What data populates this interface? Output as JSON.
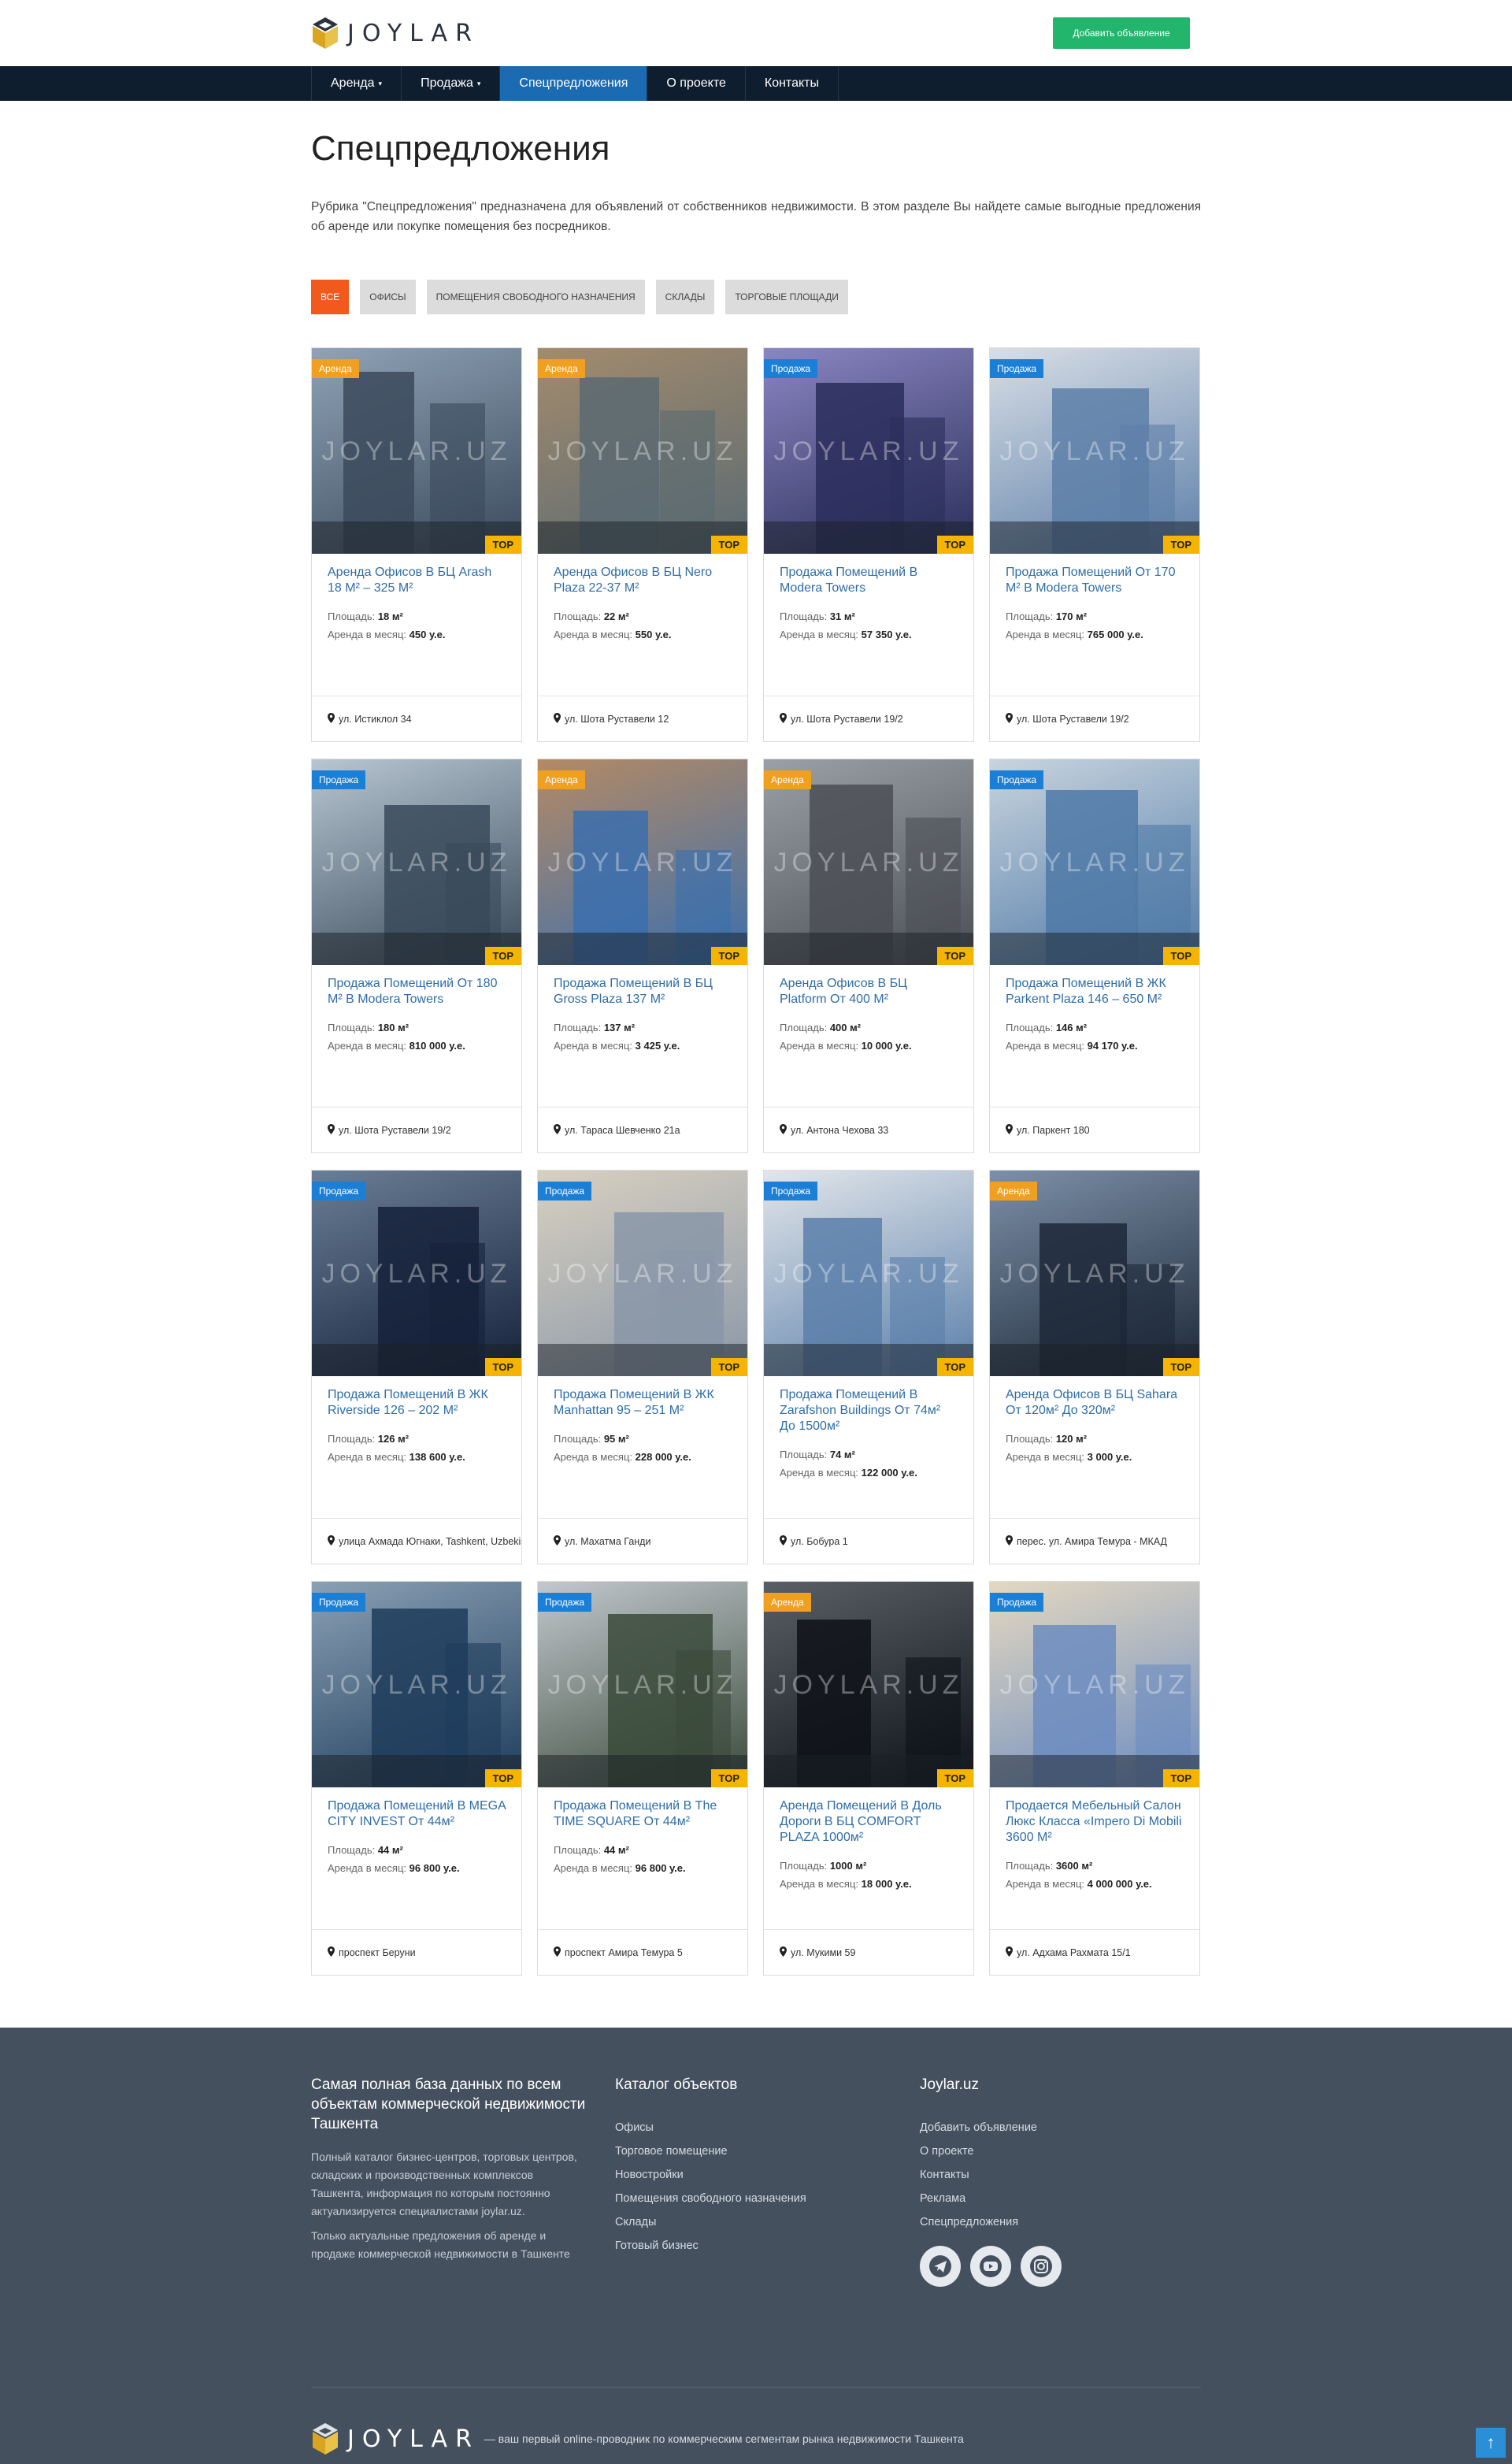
{
  "brand": {
    "name": "JOYLAR",
    "add_button": "Добавить объявление"
  },
  "nav": [
    "Аренда",
    "Продажа",
    "Спецпредложения",
    "О проекте",
    "Контакты"
  ],
  "page": {
    "title": "Спецпредложения",
    "intro": "Рубрика \"Спецпредложения\" предназначена для объявлений от собственников недвижимости. В этом разделе Вы найдете самые выгодные предложения об аренде или покупке помещения без посредников."
  },
  "filters": [
    "Все",
    "Офисы",
    "Помещения свободного назначения",
    "Склады",
    "Торговые площади"
  ],
  "labels": {
    "area": "Площадь:",
    "rent": "Аренда в месяц:",
    "top": "TOP",
    "watermark": "JOYLAR.UZ"
  },
  "colors": {
    "accent": "#f25a1d",
    "nav_bg": "#0f1e2e",
    "nav_active": "#1b6bb3",
    "add_button": "#22b56c",
    "footer_bg": "#45505e",
    "badge_rent": "#f0a020",
    "badge_sale": "#1b7fd6",
    "top_badge": "#f5b400"
  },
  "cards": [
    {
      "badge": "Аренда",
      "type": "rent",
      "title": "Аренда Офисов В БЦ Arash 18 М² – 325 М²",
      "area": "18 м²",
      "price": "450 у.е.",
      "address": "ул. Истиклол 34"
    },
    {
      "badge": "Аренда",
      "type": "rent",
      "title": "Аренда Офисов В БЦ Nero Plaza 22-37 М²",
      "area": "22 м²",
      "price": "550 у.е.",
      "address": "ул. Шота Руставели 12"
    },
    {
      "badge": "Продажа",
      "type": "sale",
      "title": "Продажа Помещений В Modera Towers",
      "area": "31 м²",
      "price": "57 350 у.е.",
      "address": "ул. Шота Руставели 19/2"
    },
    {
      "badge": "Продажа",
      "type": "sale",
      "title": "Продажа Помещений От 170 М² В Modera Towers",
      "area": "170 м²",
      "price": "765 000 у.е.",
      "address": "ул. Шота Руставели 19/2"
    },
    {
      "badge": "Продажа",
      "type": "sale",
      "title": "Продажа Помещений От 180 М² В Modera Towers",
      "area": "180 м²",
      "price": "810 000 у.е.",
      "address": "ул. Шота Руставели 19/2"
    },
    {
      "badge": "Аренда",
      "type": "rent",
      "title": "Продажа Помещений В БЦ Gross Plaza 137 М²",
      "area": "137 м²",
      "price": "3 425 у.е.",
      "address": "ул. Тараса Шевченко 21а"
    },
    {
      "badge": "Аренда",
      "type": "rent",
      "title": "Аренда Офисов В БЦ Platform От 400 М²",
      "area": "400 м²",
      "price": "10 000 у.е.",
      "address": "ул. Антона Чехова 33"
    },
    {
      "badge": "Продажа",
      "type": "sale",
      "title": "Продажа Помещений В ЖК Parkent Plaza 146 – 650 М²",
      "area": "146 м²",
      "price": "94 170 у.е.",
      "address": "ул. Паркент 180"
    },
    {
      "badge": "Продажа",
      "type": "sale",
      "title": "Продажа Помещений В ЖК Riverside 126 – 202 М²",
      "area": "126 м²",
      "price": "138 600 у.е.",
      "address": "улица Ахмада Югнаки, Tashkent, Uzbekistan"
    },
    {
      "badge": "Продажа",
      "type": "sale",
      "title": "Продажа Помещений В ЖК Manhattan 95 – 251 М²",
      "area": "95 м²",
      "price": "228 000 у.е.",
      "address": "ул. Махатма Ганди"
    },
    {
      "badge": "Продажа",
      "type": "sale",
      "title": "Продажа Помещений В Zarafshon Buildings От 74м² До 1500м²",
      "area": "74 м²",
      "price": "122 000 у.е.",
      "address": "ул. Бобура 1"
    },
    {
      "badge": "Аренда",
      "type": "rent",
      "title": "Аренда Офисов В БЦ Sahara От 120м² До 320м²",
      "area": "120 м²",
      "price": "3 000 у.е.",
      "address": "перес. ул. Амира Темура - МКАД"
    },
    {
      "badge": "Продажа",
      "type": "sale",
      "title": "Продажа Помещений В MEGA CITY INVEST От 44м²",
      "area": "44 м²",
      "price": "96 800 у.е.",
      "address": "проспект Беруни"
    },
    {
      "badge": "Продажа",
      "type": "sale",
      "title": "Продажа Помещений В The TIME SQUARE От 44м²",
      "area": "44 м²",
      "price": "96 800 у.е.",
      "address": "проспект Амира Темура 5"
    },
    {
      "badge": "Аренда",
      "type": "rent",
      "title": "Аренда Помещений В Доль Дороги В БЦ COMFORT PLAZA 1000м²",
      "area": "1000 м²",
      "price": "18 000 у.е.",
      "address": "ул. Мукими 59"
    },
    {
      "badge": "Продажа",
      "type": "sale",
      "title": "Продается Мебельный Салон Люкс Класса «Impero Di Mobili 3600 М²",
      "area": "3600 м²",
      "price": "4 000 000 у.е.",
      "address": "ул. Адхама Рахмата 15/1"
    }
  ],
  "footer": {
    "about_title": "Самая полная база данных по всем объектам коммерческой недвижимости Ташкента",
    "about_text1": "Полный каталог бизнес-центров, торговых центров, складских и производственных комплексов Ташкента, информация по которым постоянно актуализируется специалистами joylar.uz.",
    "about_text2": "Только актуальные предложения об аренде и продаже коммерческой недвижимости в Ташкенте",
    "catalog_title": "Каталог объектов",
    "catalog": [
      "Офисы",
      "Торговое помещение",
      "Новостройки",
      "Помещения свободного назначения",
      "Склады",
      "Готовый бизнес"
    ],
    "site_title": "Joylar.uz",
    "site_links": [
      "Добавить объявление",
      "О проекте",
      "Контакты",
      "Реклама",
      "Спецпредложения"
    ],
    "social": [
      "telegram-icon",
      "youtube-icon",
      "instagram-icon"
    ],
    "tagline": "— ваш первый online-проводник по коммерческим сегментам рынка недвижимости Ташкента"
  }
}
